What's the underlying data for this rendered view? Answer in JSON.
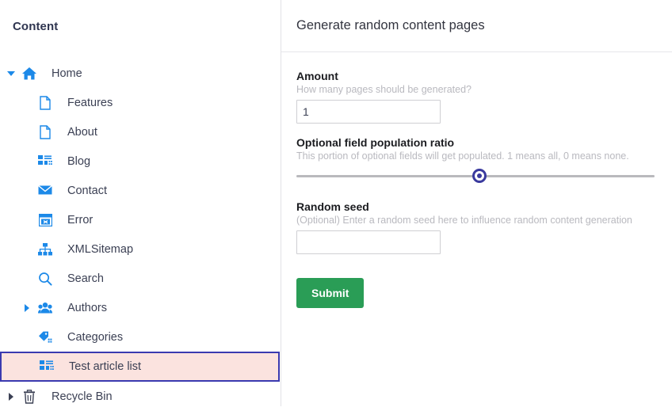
{
  "sidebar": {
    "title": "Content",
    "tree": [
      {
        "label": "Home",
        "icon": "home-icon",
        "level": 0,
        "twisty": "down",
        "selected": false
      },
      {
        "label": "Features",
        "icon": "page-icon",
        "level": 1,
        "twisty": "none",
        "selected": false
      },
      {
        "label": "About",
        "icon": "page-icon",
        "level": 1,
        "twisty": "none",
        "selected": false
      },
      {
        "label": "Blog",
        "icon": "list-grid-icon",
        "level": 1,
        "twisty": "none",
        "selected": false
      },
      {
        "label": "Contact",
        "icon": "envelope-icon",
        "level": 1,
        "twisty": "none",
        "selected": false
      },
      {
        "label": "Error",
        "icon": "error-window-icon",
        "level": 1,
        "twisty": "none",
        "selected": false
      },
      {
        "label": "XMLSitemap",
        "icon": "sitemap-icon",
        "level": 1,
        "twisty": "none",
        "selected": false
      },
      {
        "label": "Search",
        "icon": "search-icon",
        "level": 1,
        "twisty": "none",
        "selected": false
      },
      {
        "label": "Authors",
        "icon": "people-icon",
        "level": 1,
        "twisty": "right",
        "selected": false
      },
      {
        "label": "Categories",
        "icon": "tag-icon",
        "level": 1,
        "twisty": "none",
        "selected": false
      },
      {
        "label": "Test article list",
        "icon": "list-grid-icon",
        "level": 1,
        "twisty": "none",
        "selected": true
      },
      {
        "label": "Recycle Bin",
        "icon": "trash-icon",
        "level": 0,
        "twisty": "right-dark",
        "selected": false
      }
    ]
  },
  "main": {
    "title": "Generate random content pages",
    "fields": {
      "amount": {
        "label": "Amount",
        "description": "How many pages should be generated?",
        "value": "1",
        "placeholder": ""
      },
      "ratio": {
        "label": "Optional field population ratio",
        "description": "This portion of optional fields will get populated. 1 means all, 0 means none.",
        "value": "0.5",
        "min": "0",
        "max": "1"
      },
      "seed": {
        "label": "Random seed",
        "description": "(Optional) Enter a random seed here to influence random content generation",
        "value": "",
        "placeholder": ""
      }
    },
    "submit_label": "Submit"
  },
  "colors": {
    "accent_blue": "#1c89e8",
    "selected_bg": "#fbe3df",
    "selected_border": "#3a3ab0",
    "submit_green": "#2a9d56",
    "slider_indigo": "#3a3a9e"
  }
}
